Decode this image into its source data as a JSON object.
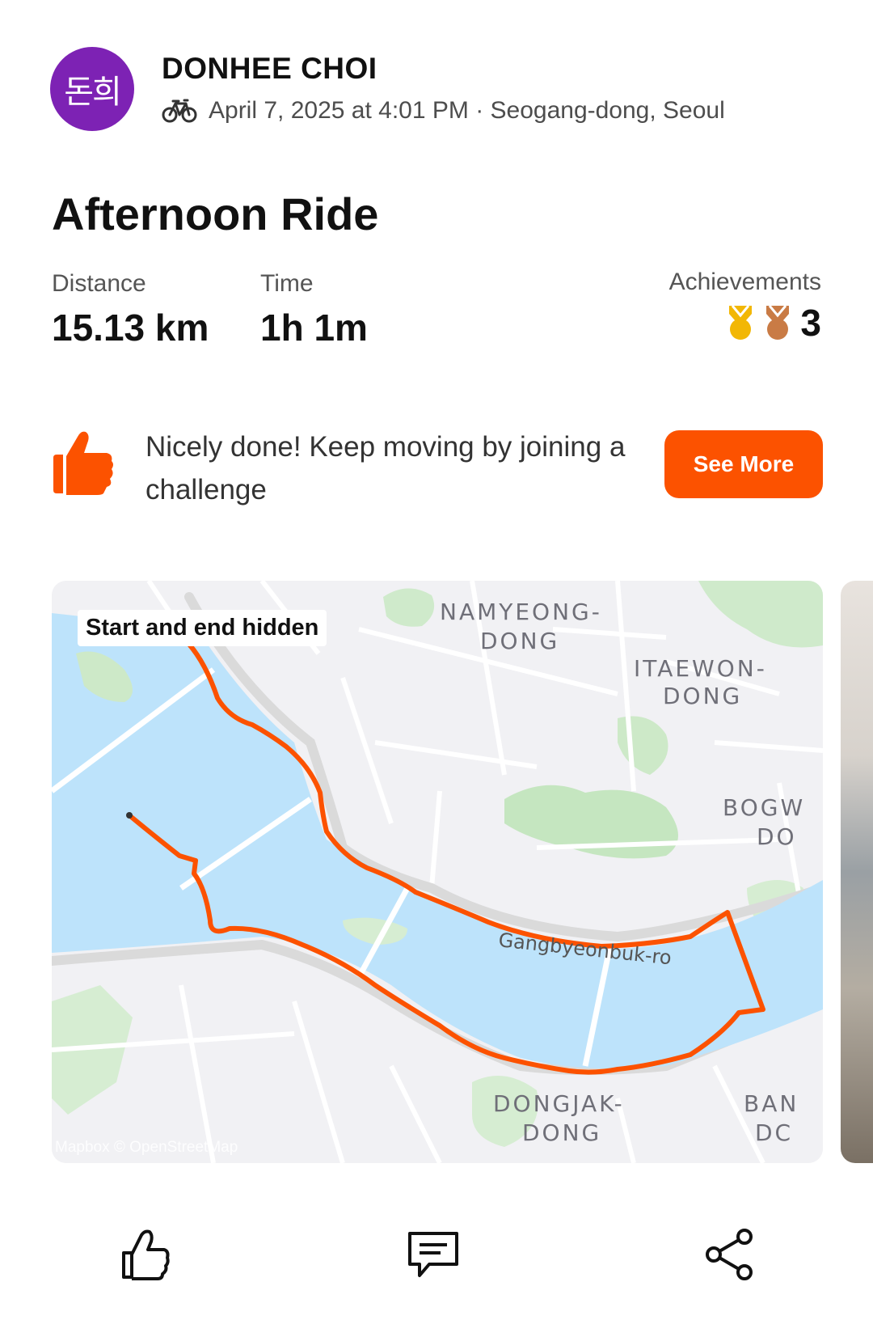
{
  "athlete": {
    "avatar_text": "돈희",
    "avatar_color": "#7d22b4",
    "name": "DONHEE CHOI"
  },
  "activity": {
    "sport_icon": "bicycle-icon",
    "meta": "April 7, 2025 at 4:01 PM · Seogang-dong, Seoul",
    "title": "Afternoon Ride"
  },
  "stats": {
    "distance_label": "Distance",
    "distance_value": "15.13 km",
    "time_label": "Time",
    "time_value": "1h 1m",
    "achievements_label": "Achievements",
    "achievements_count": "3",
    "medals": [
      "gold-medal-icon",
      "bronze-medal-icon"
    ]
  },
  "promo": {
    "icon": "thumbs-up-icon",
    "text": "Nicely done! Keep moving by joining a challenge",
    "button_label": "See More"
  },
  "map": {
    "privacy_chip": "Start and end hidden",
    "attribution": "Mapbox © OpenStreetMap",
    "labels": {
      "namyeong_1": "NAMYEONG-",
      "namyeong_2": "DONG",
      "itaewon_1": "ITAEWON-",
      "itaewon_2": "DONG",
      "bogwang_1": "BOGW",
      "bogwang_2": "DO",
      "dongjak_1": "DONGJAK-",
      "dongjak_2": "DONG",
      "banpo_1": "BAN",
      "banpo_2": "DC",
      "road": "Gangbyeonbuk-ro"
    },
    "route_color": "#fc5200",
    "water_color": "#bde3fb"
  },
  "actions": [
    "kudos-icon",
    "comment-icon",
    "share-icon"
  ],
  "colors": {
    "brand_orange": "#fc5200",
    "gold": "#f2b705",
    "bronze": "#c97b45"
  }
}
